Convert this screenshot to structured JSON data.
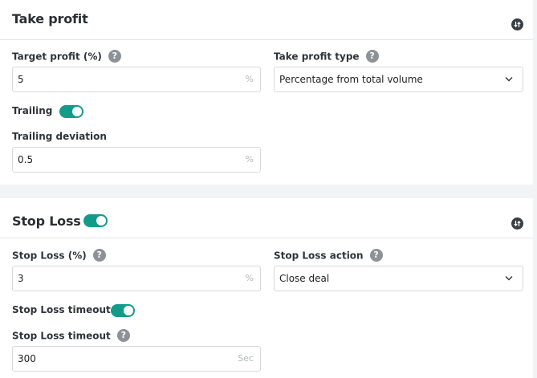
{
  "take_profit": {
    "title": "Take profit",
    "target_profit": {
      "label": "Target profit (%)",
      "value": "5",
      "unit": "%"
    },
    "take_profit_type": {
      "label": "Take profit type",
      "value": "Percentage from total volume"
    },
    "trailing": {
      "label": "Trailing",
      "enabled": true
    },
    "trailing_deviation": {
      "label": "Trailing deviation",
      "value": "0.5",
      "unit": "%"
    }
  },
  "stop_loss": {
    "title": "Stop Loss",
    "enabled": true,
    "stop_loss_pct": {
      "label": "Stop Loss (%)",
      "value": "3",
      "unit": "%"
    },
    "stop_loss_action": {
      "label": "Stop Loss action",
      "value": "Close deal"
    },
    "stop_loss_timeout_toggle": {
      "label": "Stop Loss timeout",
      "enabled": true
    },
    "stop_loss_timeout": {
      "label": "Stop Loss timeout",
      "value": "300",
      "unit": "Sec"
    }
  },
  "help_glyph": "?",
  "colors": {
    "toggle_on": "#139b8a",
    "help_icon": "#8d9298",
    "header_icon": "#3a3f45"
  }
}
